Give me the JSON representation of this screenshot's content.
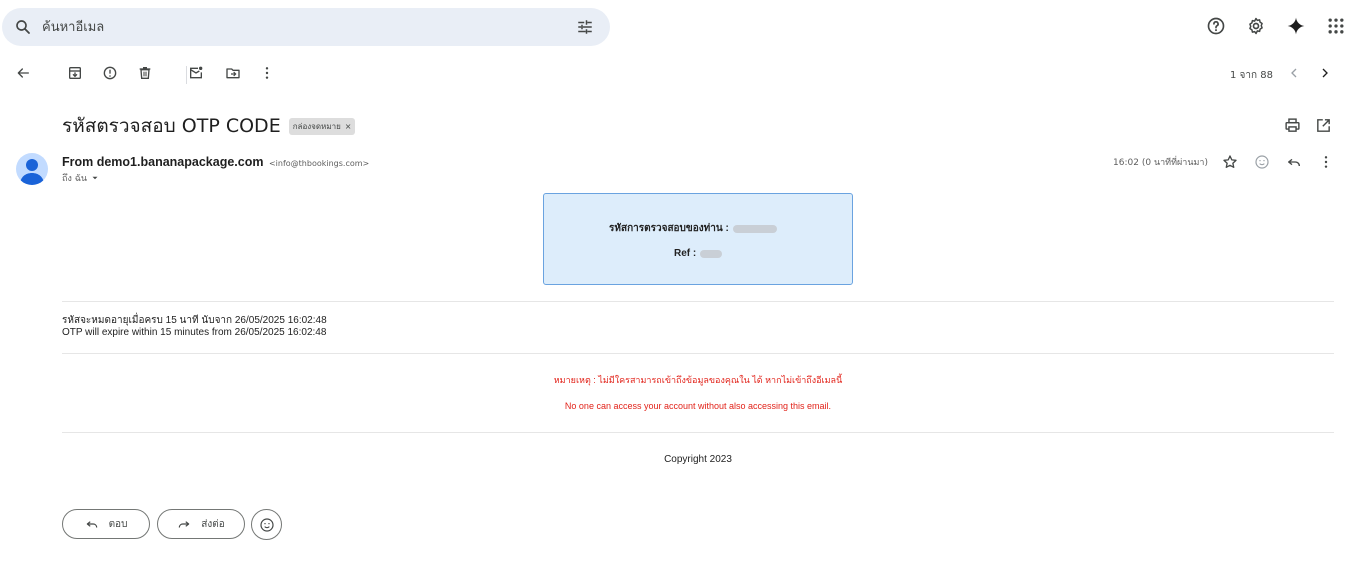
{
  "search": {
    "placeholder": "ค้นหาอีเมล"
  },
  "toolbar": {
    "pager": "1 จาก 88"
  },
  "email": {
    "subject": "รหัสตรวจสอบ OTP CODE",
    "label": "กล่องจดหมาย",
    "label_close": "×",
    "sender_name": "From demo1.bananapackage.com",
    "sender_address": "<info@thbookings.com>",
    "to": "ถึง ฉัน",
    "time": "16:02 (0 นาทีที่ผ่านมา)"
  },
  "body": {
    "otp_label": "รหัสการตรวจสอบของท่าน :",
    "ref_label": "Ref :",
    "expire_th": "รหัสจะหมดอายุเมื่อครบ 15 นาที นับจาก 26/05/2025 16:02:48",
    "expire_en": "OTP will expire within 15 minutes from 26/05/2025 16:02:48",
    "note_th": "หมายเหตุ : ไม่มีใครสามารถเข้าถึงข้อมูลของคุณใน ได้ หากไม่เข้าถึงอีเมลนี้",
    "note_en": "No one can access your account without also accessing this email.",
    "copyright": "Copyright 2023"
  },
  "reply_bar": {
    "reply": "ตอบ",
    "forward": "ส่งต่อ"
  },
  "colors": {
    "accent": "#0b57d0",
    "warning_text": "#e2231a",
    "otp_bg": "#ddedfb",
    "otp_border": "#6aa3e0",
    "search_bg": "#e9eef6"
  }
}
